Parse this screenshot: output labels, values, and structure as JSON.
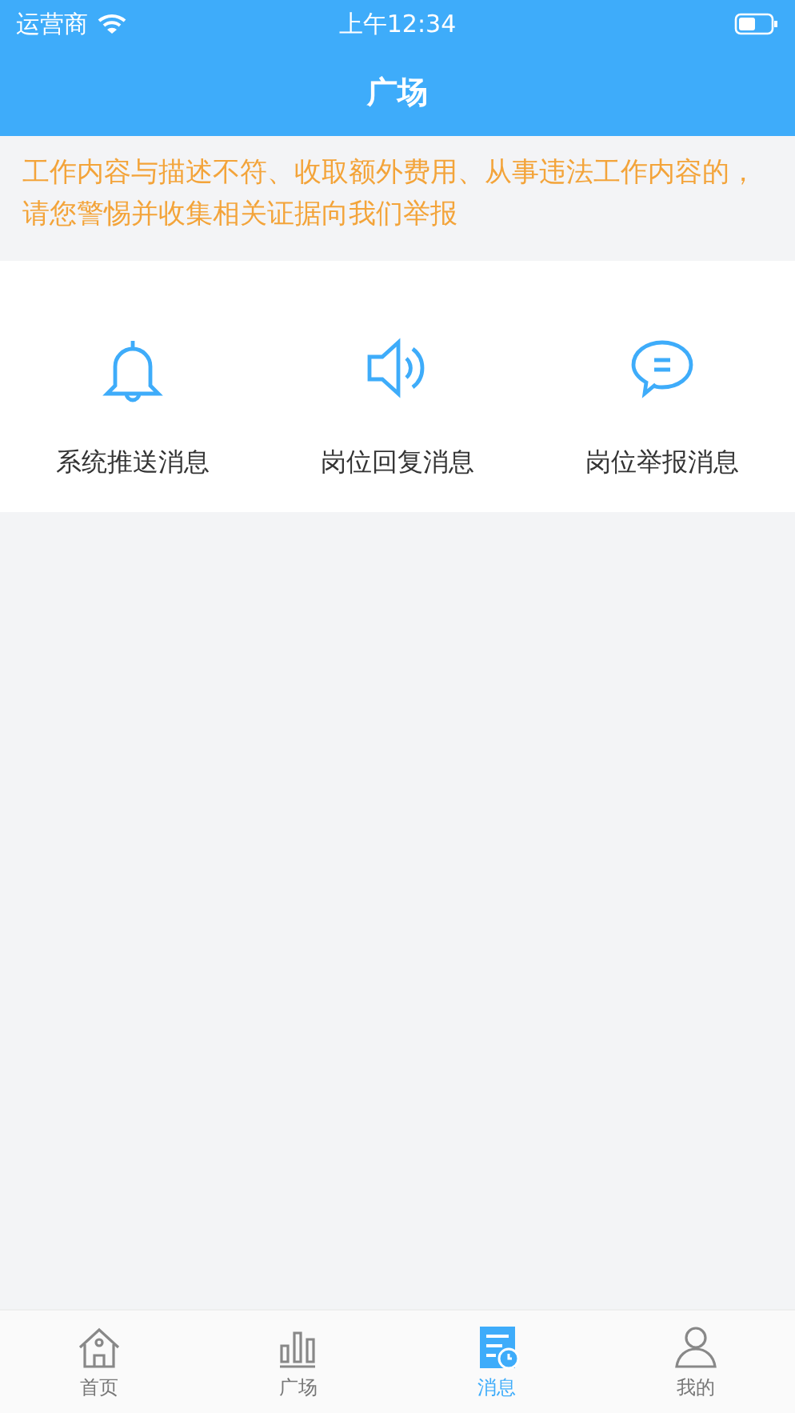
{
  "status_bar": {
    "carrier": "运营商",
    "time": "上午12:34"
  },
  "nav": {
    "title": "广场"
  },
  "notice": "工作内容与描述不符、收取额外费用、从事违法工作内容的，请您警惕并收集相关证据向我们举报",
  "actions": [
    {
      "kind": "bell",
      "label": "系统推送消息"
    },
    {
      "kind": "speaker",
      "label": "岗位回复消息"
    },
    {
      "kind": "chat",
      "label": "岗位举报消息"
    }
  ],
  "tabs": [
    {
      "kind": "home",
      "label": "首页",
      "selected": false
    },
    {
      "kind": "bars",
      "label": "广场",
      "selected": false
    },
    {
      "kind": "messages",
      "label": "消息",
      "selected": true
    },
    {
      "kind": "person",
      "label": "我的",
      "selected": false
    }
  ]
}
